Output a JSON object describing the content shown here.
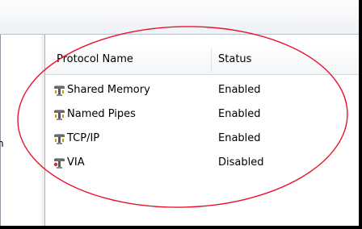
{
  "tree": {
    "partial_text": "n"
  },
  "list": {
    "columns": {
      "name": "Protocol Name",
      "status": "Status"
    },
    "rows": [
      {
        "name": "Shared Memory",
        "status": "Enabled",
        "icon": "protocol-icon"
      },
      {
        "name": "Named Pipes",
        "status": "Enabled",
        "icon": "protocol-icon"
      },
      {
        "name": "TCP/IP",
        "status": "Enabled",
        "icon": "protocol-icon"
      },
      {
        "name": "VIA",
        "status": "Disabled",
        "icon": "protocol-icon-disabled"
      }
    ]
  },
  "colors": {
    "annotation": "#e8132b",
    "border": "#000000",
    "header_bg": "#f3f5f7"
  }
}
